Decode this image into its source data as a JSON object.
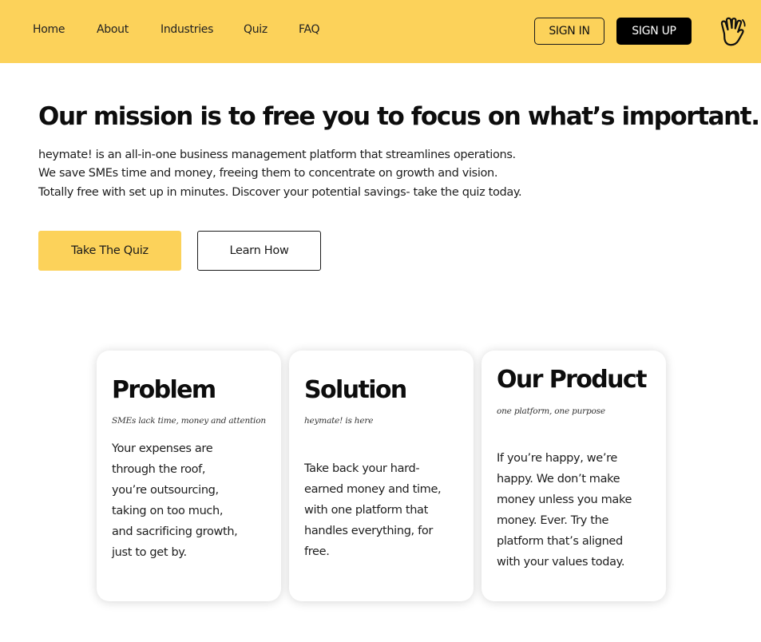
{
  "nav": {
    "links": [
      "Home",
      "About",
      "Industries",
      "Quiz",
      "FAQ"
    ],
    "sign_in": "SIGN IN",
    "sign_up": "SIGN UP",
    "logo_icon": "waving-hand-icon",
    "background_color": "#FCD25A"
  },
  "hero": {
    "title": "Our mission is to free you to focus on what’s important.",
    "lines": [
      "heymate! is an all-in-one business management platform that streamlines operations.",
      "We save SMEs time and money, freeing them to concentrate on growth and vision.",
      "Totally free with set up in minutes. Discover your potential savings- take the quiz today."
    ],
    "primary_button": "Take The Quiz",
    "secondary_button": "Learn How",
    "accent_color": "#FCD25A"
  },
  "cards": [
    {
      "title": "Problem",
      "tagline": "SMEs lack time, money and attention",
      "body": [
        "Your expenses are",
        "through the roof,",
        "you’re outsourcing,",
        "taking on too much,",
        "and sacrificing growth,",
        "just to get by."
      ]
    },
    {
      "title": "Solution",
      "tagline": "heymate! is here",
      "body": [
        "Take back your hard-",
        "earned money and time,",
        "with one platform that",
        "handles everything, for",
        "free."
      ]
    },
    {
      "title": "Our Product",
      "tagline": "one platform, one purpose",
      "body": [
        "If you’re happy, we’re",
        "happy. We don’t make",
        "money unless you make",
        "money. Ever. Try the",
        "platform that’s aligned",
        "with your values today."
      ]
    }
  ]
}
